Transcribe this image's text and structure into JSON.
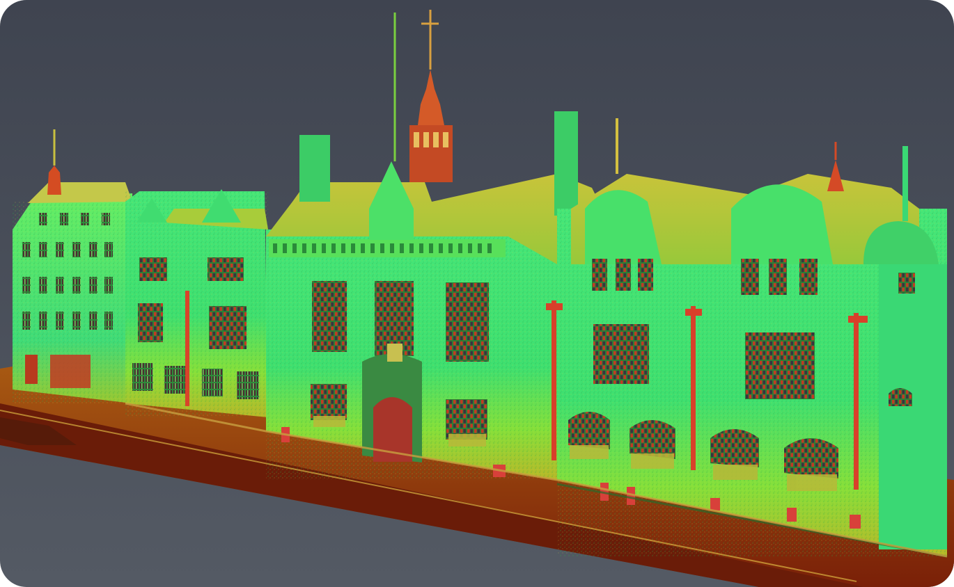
{
  "scene": {
    "subject": "point-cloud-building-facade",
    "colors": {
      "sky_top": "#3f4450",
      "sky_bottom": "#4f5560",
      "ground": "#3a3f4a",
      "facade_green": "#35e06a",
      "facade_lime": "#8ee832",
      "roof_yellow": "#b8c836",
      "accent_red": "#c8381e",
      "street_orange": "#b84a10",
      "dark_red": "#6e1a08",
      "window_dark": "#2a6a2a"
    }
  }
}
